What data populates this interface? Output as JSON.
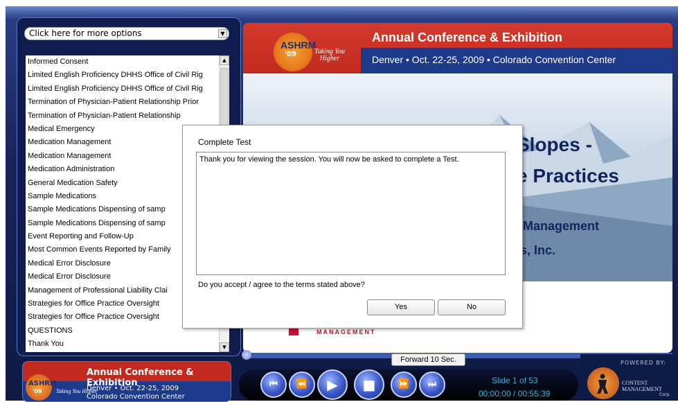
{
  "options_select": {
    "value": "Click here for more options"
  },
  "topics": [
    "Informed Consent",
    "Limited English Proficiency DHHS Office of Civil Rig",
    "Limited English Proficiency DHHS Office of Civil Rig",
    "Termination of Physician-Patient Relationship Prior",
    "Termination of Physician-Patient Relationship",
    "Medical Emergency",
    "Medication Management",
    "Medication Management",
    "Medication Administration",
    "General Medication Safety",
    "Sample Medications",
    "Sample Medications Dispensing of samp",
    "Sample Medications Dispensing of samp",
    "Event Reporting and Follow-Up",
    "Most Common Events Reported by Family",
    "Medical Error Disclosure",
    "Medical Error Disclosure",
    "Management of Professional Liability Clai",
    "Strategies for Office Practice Oversight",
    "Strategies for Office Practice Oversight",
    "QUESTIONS",
    "Thank You"
  ],
  "banner": {
    "org": "ASHRM",
    "year": "'09",
    "tagline_1": "Taking You",
    "tagline_2": "Higher",
    "title": "Annual Conference & Exhibition",
    "subtitle": "Denver • Oct. 22-25, 2009 • Colorado Convention Center"
  },
  "mini_banner": {
    "org": "ASHRM",
    "year": "'09",
    "tagline": "Taking You Higher",
    "title": "Annual Conference & Exhibition",
    "sub_1": "Denver • Oct. 22-25, 2009",
    "sub_2": "Colorado Convention Center"
  },
  "slide": {
    "line_1": "Slopes -",
    "line_2": "e Practices",
    "line_3": "Management",
    "line_4": "s, Inc.",
    "footer": "MANAGEMENT"
  },
  "player": {
    "forward_label": "Forward 10 Sec.",
    "slide_counter": "Slide 1 of 53",
    "time": "00:00:00 / 00:55:39",
    "powered_by": "POWERED BY:",
    "company_1": "CONTENT",
    "company_2": "MANAGEMENT",
    "company_3": "Corp.",
    "buttons": {
      "first": "⏮",
      "rewind": "⏪",
      "play": "▶",
      "stop": "■",
      "forward": "⏩",
      "last": "⏭"
    }
  },
  "dialog": {
    "title": "Complete Test",
    "message": "Thank you for viewing the session. You will now be asked to complete a Test.",
    "question": "Do you accept / agree to the terms stated above?",
    "yes_label": "Yes",
    "no_label": "No"
  },
  "colors": {
    "frame": "#16245a",
    "banner_red": "#c22a1f",
    "banner_blue": "#1d3b8a",
    "counter_text": "#2fb8e0"
  }
}
